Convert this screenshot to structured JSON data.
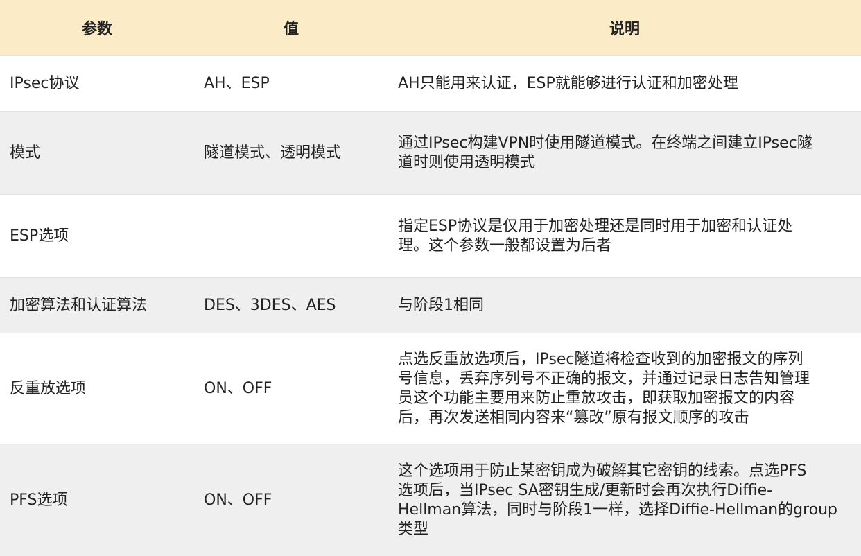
{
  "header": {
    "param": "参数",
    "value": "值",
    "desc": "说明"
  },
  "rows": [
    {
      "param": "IPsec协议",
      "value": "AH、ESP",
      "desc": [
        "AH只能用来认证，ESP就能够进行认证和加密处理"
      ]
    },
    {
      "param": "模式",
      "value": "隧道模式、透明模式",
      "desc": [
        "通过IPsec构建VPN时使用隧道模式。在终端之间建立IPsec隧",
        "道时则使用透明模式"
      ]
    },
    {
      "param": "ESP选项",
      "value": "",
      "desc": [
        "指定ESP协议是仅用于加密处理还是同时用于加密和认证处",
        "理。这个参数一般都设置为后者"
      ]
    },
    {
      "param": "加密算法和认证算法",
      "value": "DES、3DES、AES",
      "desc": [
        "与阶段1相同"
      ]
    },
    {
      "param": "反重放选项",
      "value": "ON、OFF",
      "desc": [
        "点选反重放选项后，IPsec隧道将检查收到的加密报文的序列",
        "号信息，丢弃序列号不正确的报文，并通过记录日志告知管理",
        "员这个功能主要用来防止重放攻击，即获取加密报文的内容",
        "后，再次发送相同内容来“篡改”原有报文顺序的攻击"
      ]
    },
    {
      "param": "PFS选项",
      "value": "ON、OFF",
      "desc": [
        "这个选项用于防止某密钥成为破解其它密钥的线索。点选PFS",
        "选项后，当IPsec SA密钥生成/更新时会再次执行Diffie-",
        "Hellman算法，同时与阶段1一样，选择Diffie-Hellman的group",
        "类型"
      ]
    }
  ]
}
